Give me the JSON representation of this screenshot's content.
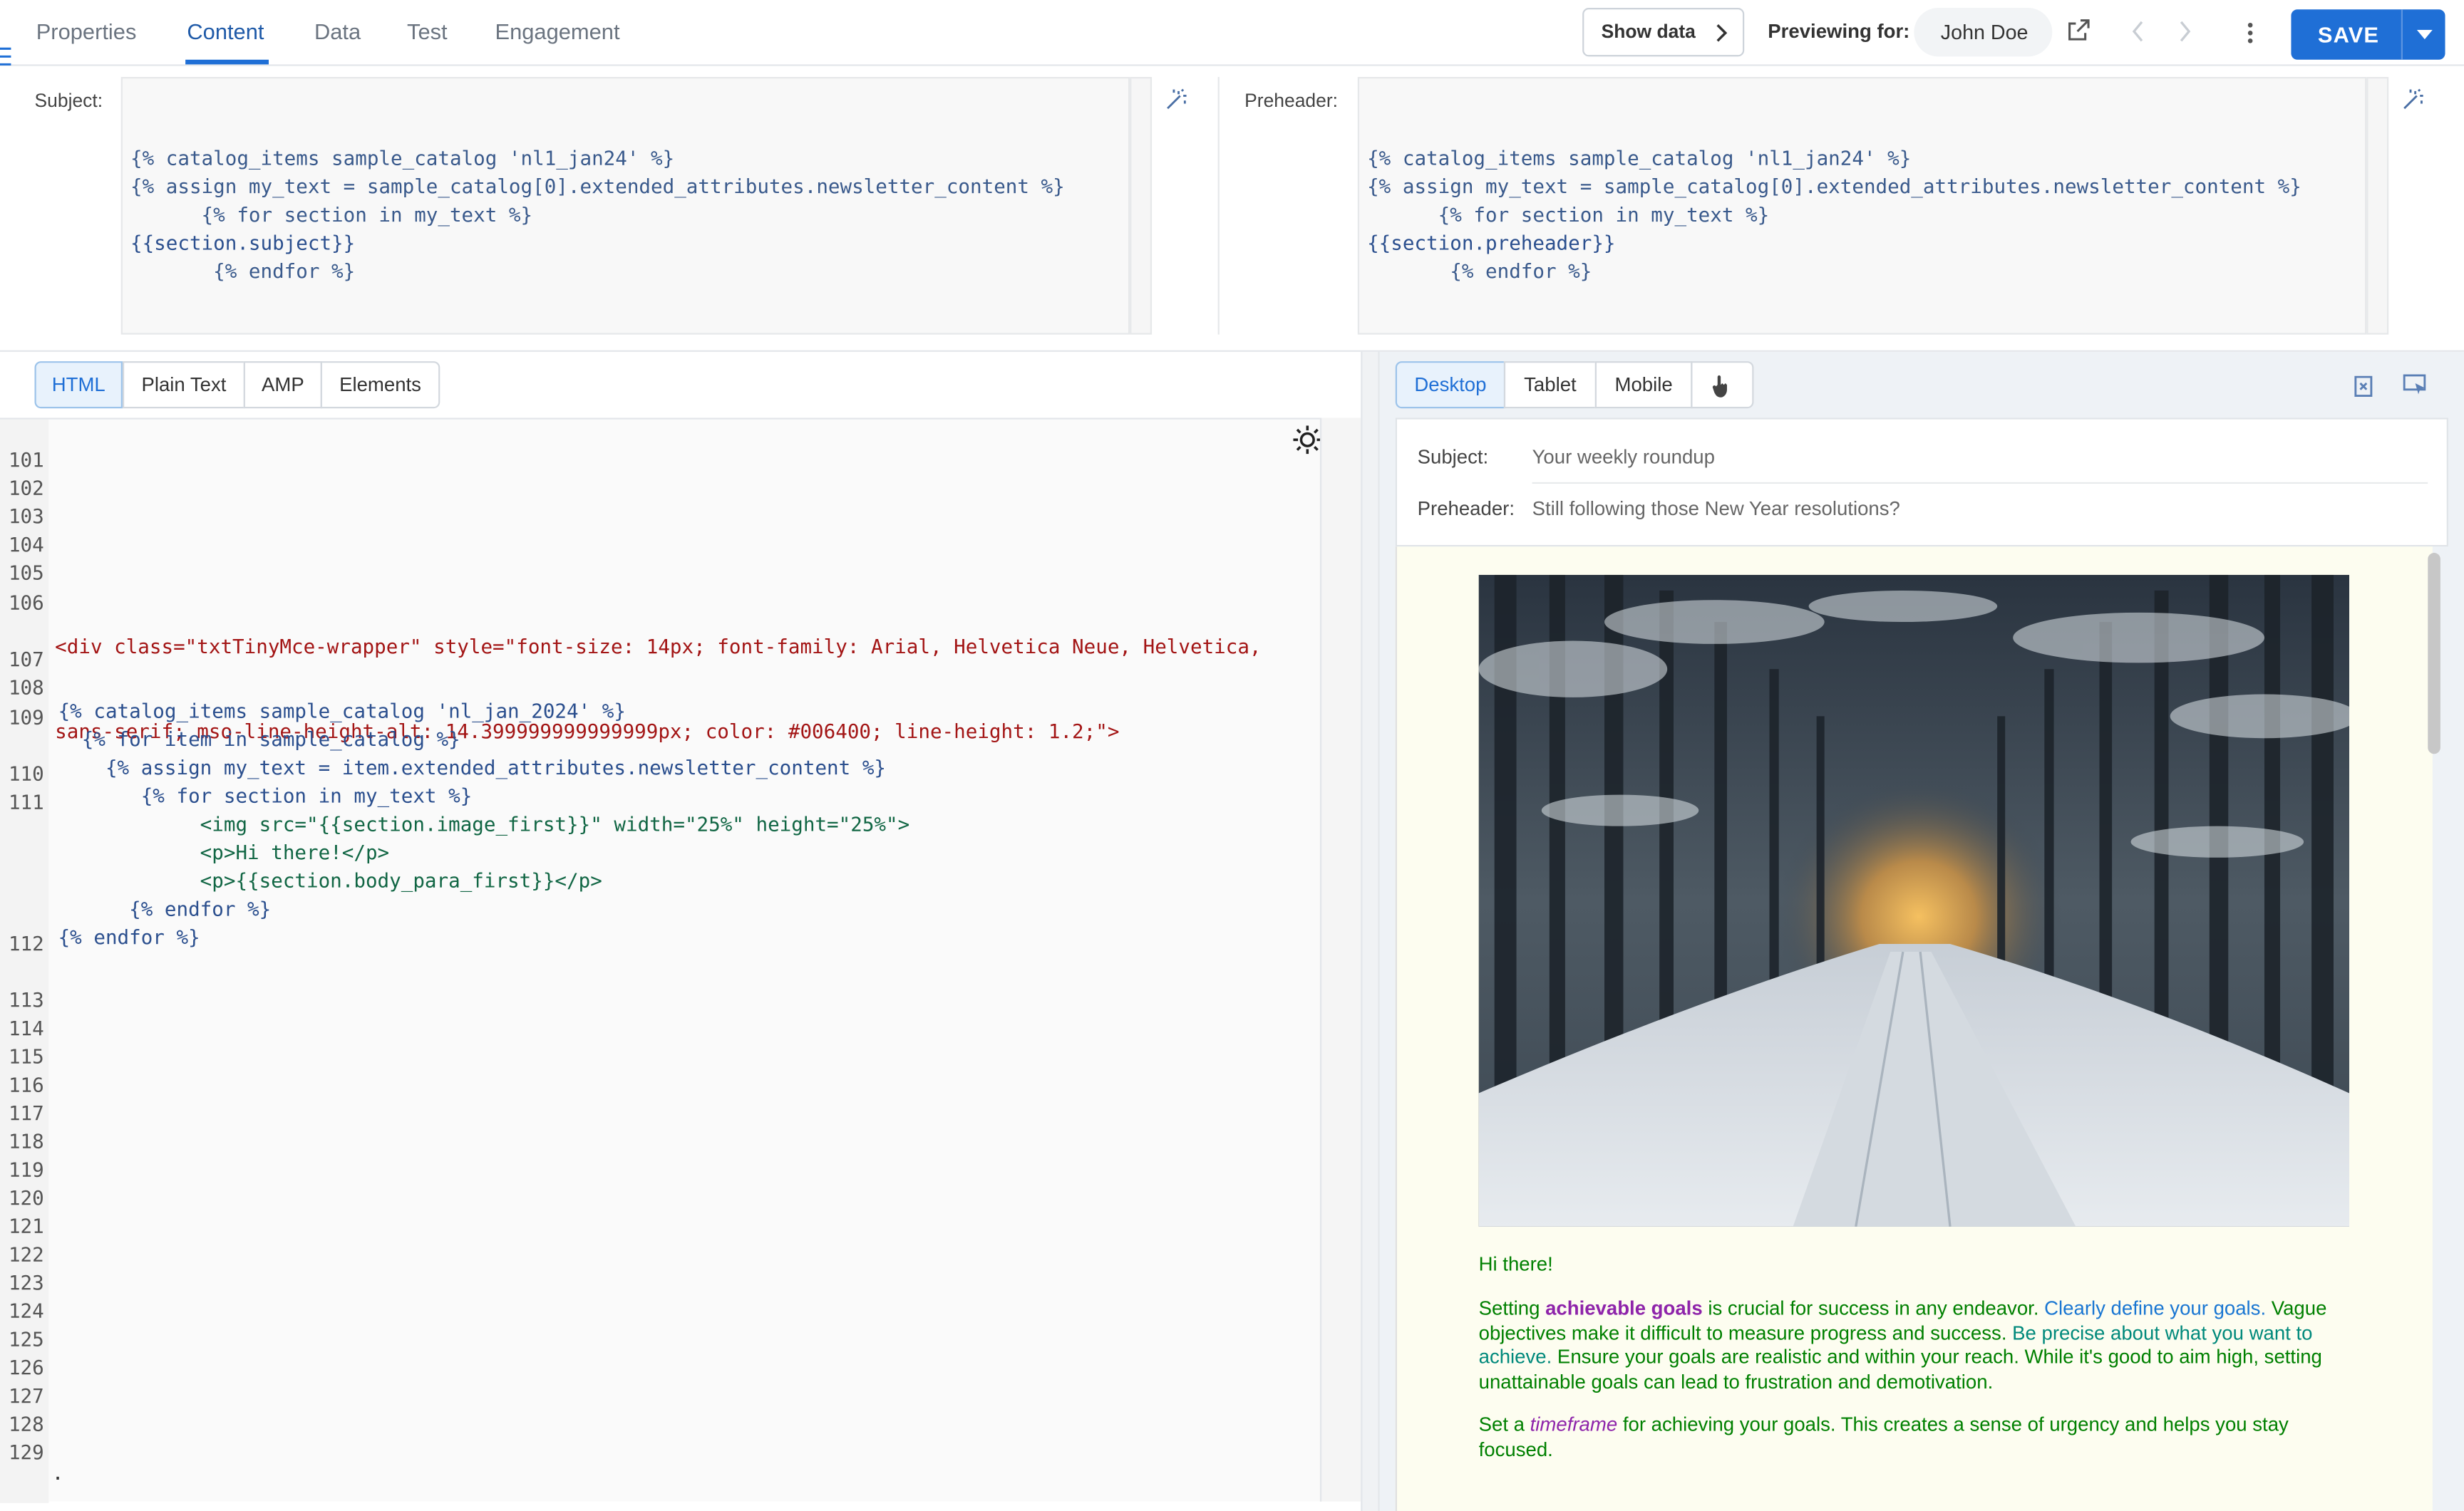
{
  "topbar": {
    "tabs": [
      "Properties",
      "Content",
      "Data",
      "Test",
      "Engagement"
    ],
    "active_tab": "Content",
    "show_data_label": "Show data",
    "previewing_label": "Previewing for:",
    "previewing_user": "John Doe",
    "save_label": "SAVE"
  },
  "subject_row": {
    "subject_label": "Subject:",
    "subject_code": [
      "{% catalog_items sample_catalog 'nl1_jan24' %}",
      "{% assign my_text = sample_catalog[0].extended_attributes.newsletter_content %}",
      "      {% for section in my_text %}",
      "{{section.subject}}",
      "       {% endfor %}"
    ],
    "preheader_label": "Preheader:",
    "preheader_code": [
      "{% catalog_items sample_catalog 'nl1_jan24' %}",
      "{% assign my_text = sample_catalog[0].extended_attributes.newsletter_content %}",
      "      {% for section in my_text %}",
      "{{section.preheader}}",
      "       {% endfor %}"
    ]
  },
  "editor": {
    "tabs": [
      "HTML",
      "Plain Text",
      "AMP",
      "Elements"
    ],
    "active_tab": "HTML",
    "line_numbers": [
      "101",
      "102",
      "103",
      "104",
      "105",
      "106",
      "107",
      "108",
      "109",
      "110",
      "111",
      "112",
      "113",
      "114",
      "115",
      "116",
      "117",
      "118",
      "119",
      "120",
      "121",
      "122",
      "123",
      "124",
      "125",
      "126",
      "127",
      "128",
      "129"
    ],
    "line106a": "<div class=\"txtTinyMce-wrapper\" style=\"font-size: 14px; font-family: Arial, Helvetica Neue, Helvetica,",
    "line106b": "sans-serif; mso-line-height-alt: 14.399999999999999px; color: #006400; line-height: 1.2;\">",
    "liquid_lines": [
      "{% catalog_items sample_catalog 'nl_jan_2024' %}",
      "  {% for item in sample_catalog %}",
      "    {% assign my_text = item.extended_attributes.newsletter_content %}",
      "       {% for section in my_text %}",
      "            <img src=\"{{section.image_first}}\" width=\"25%\" height=\"25%\">",
      "            <p>Hi there!</p>",
      "            <p>{{section.body_para_first}}</p>",
      "      {% endfor %}",
      "{% endfor %}"
    ],
    "trailing_dot": "."
  },
  "preview": {
    "devices": [
      "Desktop",
      "Tablet",
      "Mobile"
    ],
    "active_device": "Desktop",
    "subject_label": "Subject:",
    "subject_value": "Your weekly roundup",
    "preheader_label": "Preheader:",
    "preheader_value": "Still following those New Year resolutions?",
    "greeting": "Hi there!",
    "p1": {
      "a": "Setting ",
      "b": "achievable goals",
      "c": " is crucial for success in any endeavor. ",
      "d": "Clearly define your goals.",
      "e": " Vague objectives make it difficult to measure progress and success. ",
      "f": "Be precise about what you want to achieve.",
      "g": " Ensure your goals are realistic and within your reach. While it's good to aim high, setting unattainable goals can lead to frustration and demotivation."
    },
    "p2": {
      "a": "Set a ",
      "b": "timeframe",
      "c": " for achieving your goals. This creates a sense of urgency and helps you stay focused."
    }
  },
  "colors": {
    "accent": "#1f6fd6",
    "text_green": "#008000",
    "purple": "#8e24aa"
  },
  "icons": [
    "chevron-right-icon",
    "external-link-icon",
    "chevron-left-icon",
    "more-vertical-icon",
    "caret-down-icon",
    "magic-wand-icon",
    "sun-icon",
    "search-icon",
    "pointer-icon",
    "clear-icon",
    "select-icon"
  ]
}
